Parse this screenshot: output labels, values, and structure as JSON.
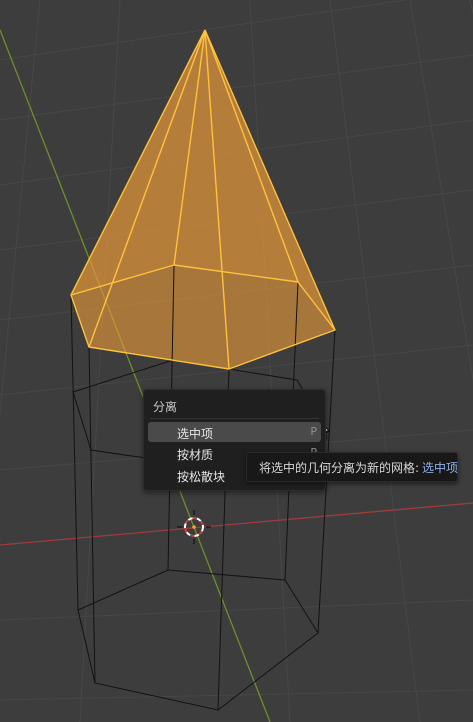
{
  "menu": {
    "title": "分离",
    "items": [
      {
        "label": "选中项",
        "shortcut": "P",
        "active": true
      },
      {
        "label": "按材质",
        "shortcut": "P",
        "active": false
      },
      {
        "label": "按松散块",
        "shortcut": "",
        "active": false
      }
    ]
  },
  "tooltip": {
    "text": "将选中的几何分离为新的网格:",
    "value": "选中项"
  },
  "colors": {
    "background": "#3d3d3d",
    "grid": "#4a4a4a",
    "x_axis": "#a03c3c",
    "y_axis": "#6f8f2a",
    "selected_edge": "#ffc23a",
    "selected_face": "#e89a3a",
    "wire": "#101010"
  },
  "icons": [
    "3d-cursor-icon",
    "mouse-pointer-icon"
  ]
}
